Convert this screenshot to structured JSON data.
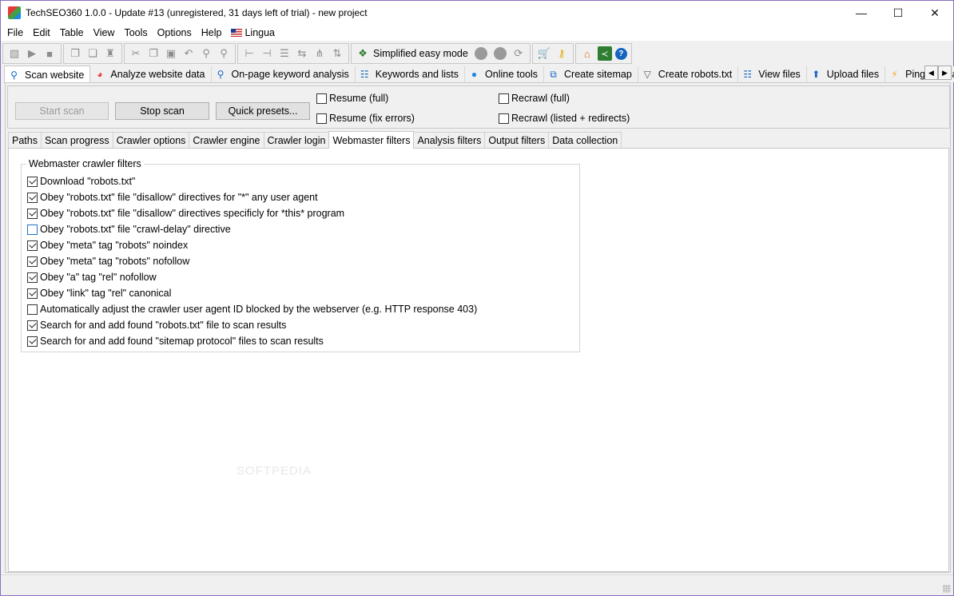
{
  "window": {
    "title": "TechSEO360 1.0.0 - Update #13 (unregistered, 31 days left of trial) - new project",
    "minimize_glyph": "—",
    "maximize_glyph": "☐",
    "close_glyph": "✕"
  },
  "menu": [
    "File",
    "Edit",
    "Table",
    "View",
    "Tools",
    "Options",
    "Help",
    "Lingua"
  ],
  "toolbar": {
    "mode_label": "Simplified easy mode"
  },
  "main_tabs": [
    {
      "label": "Scan website",
      "icon": "magnifier-icon",
      "active": true
    },
    {
      "label": "Analyze website data",
      "icon": "chart-icon"
    },
    {
      "label": "On-page keyword analysis",
      "icon": "magnifier-icon"
    },
    {
      "label": "Keywords and lists",
      "icon": "list-icon"
    },
    {
      "label": "Online tools",
      "icon": "globe-icon"
    },
    {
      "label": "Create sitemap",
      "icon": "sitemap-icon"
    },
    {
      "label": "Create robots.txt",
      "icon": "filter-icon"
    },
    {
      "label": "View files",
      "icon": "list-icon"
    },
    {
      "label": "Upload files",
      "icon": "upload-icon"
    },
    {
      "label": "Ping sitema",
      "icon": "lightning-icon"
    }
  ],
  "scan": {
    "start_label": "Start scan",
    "stop_label": "Stop scan",
    "presets_label": "Quick presets...",
    "resume_full": "Resume (full)",
    "resume_fix": "Resume (fix errors)",
    "recrawl_full": "Recrawl (full)",
    "recrawl_listed": "Recrawl (listed + redirects)"
  },
  "sub_tabs": [
    {
      "label": "Paths"
    },
    {
      "label": "Scan progress"
    },
    {
      "label": "Crawler options"
    },
    {
      "label": "Crawler engine"
    },
    {
      "label": "Crawler login"
    },
    {
      "label": "Webmaster filters",
      "active": true
    },
    {
      "label": "Analysis filters"
    },
    {
      "label": "Output filters"
    },
    {
      "label": "Data collection"
    }
  ],
  "filters": {
    "group_title": "Webmaster crawler filters",
    "items": [
      {
        "label": "Download \"robots.txt\"",
        "checked": true
      },
      {
        "label": "Obey \"robots.txt\" file \"disallow\" directives for \"*\" any user agent",
        "checked": true
      },
      {
        "label": "Obey \"robots.txt\" file \"disallow\" directives specificly for *this* program",
        "checked": true
      },
      {
        "label": "Obey \"robots.txt\" file \"crawl-delay\" directive",
        "checked": false,
        "focused": true
      },
      {
        "label": "Obey \"meta\" tag \"robots\" noindex",
        "checked": true
      },
      {
        "label": "Obey \"meta\" tag \"robots\" nofollow",
        "checked": true
      },
      {
        "label": "Obey \"a\" tag \"rel\" nofollow",
        "checked": true
      },
      {
        "label": "Obey \"link\" tag \"rel\" canonical",
        "checked": true
      },
      {
        "label": "Automatically adjust the crawler user agent ID blocked by the webserver (e.g. HTTP response 403)",
        "checked": false
      },
      {
        "label": "Search for and add found \"robots.txt\" file to scan results",
        "checked": true
      },
      {
        "label": "Search for and add found \"sitemap protocol\" files to scan results",
        "checked": true
      }
    ]
  },
  "watermark": "SOFTPEDIA"
}
